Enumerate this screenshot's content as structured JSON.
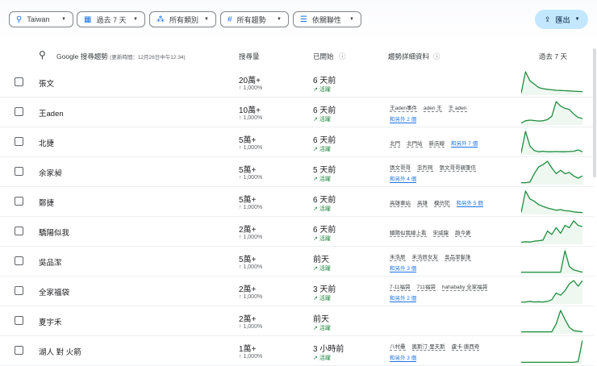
{
  "filters": [
    {
      "icon": "location-pin-icon",
      "glyph": "⚲",
      "label": "Taiwan"
    },
    {
      "icon": "calendar-icon",
      "glyph": "▦",
      "label": "過去 7 天"
    },
    {
      "icon": "category-icon",
      "glyph": "⁂",
      "label": "所有類別"
    },
    {
      "icon": "hashtag-icon",
      "glyph": "#",
      "label": "所有趨勢"
    },
    {
      "icon": "sort-icon",
      "glyph": "☰",
      "label": "依關聯性"
    }
  ],
  "export": {
    "label": "匯出"
  },
  "header": {
    "title": "Google 搜尋趨勢",
    "updated": "(更新時間：12月26日中午12:34)",
    "volume": "搜尋量",
    "started": "已開始",
    "details": "趨勢詳細資料",
    "past": "過去 7 天"
  },
  "accent": "#1e8e3e",
  "rows": [
    {
      "name": "張文",
      "volume": "20萬+",
      "pct": "↑ 1,000%",
      "started": "6 天前",
      "status": "活躍",
      "terms": [],
      "more": "",
      "trend": [
        5,
        100,
        60,
        45,
        30,
        25,
        22,
        20,
        18,
        17,
        16,
        15,
        14,
        13,
        12
      ]
    },
    {
      "name": "王aden",
      "volume": "10萬+",
      "pct": "↑ 1,000%",
      "started": "6 天前",
      "status": "活躍",
      "terms": [
        "王aden事件",
        "aden 王",
        "王 aden"
      ],
      "more": "和另外 2 個",
      "trend": [
        5,
        15,
        18,
        16,
        14,
        15,
        20,
        35,
        100,
        80,
        70,
        65,
        45,
        30,
        25
      ]
    },
    {
      "name": "北捷",
      "volume": "5萬+",
      "pct": "↑ 1,000%",
      "started": "6 天前",
      "status": "活躍",
      "terms": [
        "北門",
        "北門站",
        "新店線"
      ],
      "more": "和另外 7 個",
      "trend": [
        5,
        100,
        35,
        15,
        10,
        12,
        10,
        10,
        11,
        10,
        10,
        11,
        12,
        18,
        10
      ]
    },
    {
      "name": "余家昶",
      "volume": "5萬+",
      "pct": "↑ 1,000%",
      "started": "5 天前",
      "status": "活躍",
      "terms": [
        "張文哥哥",
        "忠烈祠",
        "張文哥哥親筆信"
      ],
      "more": "和另外 4 個",
      "trend": [
        5,
        5,
        8,
        45,
        75,
        85,
        100,
        70,
        45,
        60,
        45,
        50,
        35,
        25,
        35
      ]
    },
    {
      "name": "鄭捷",
      "volume": "5萬+",
      "pct": "↑ 1,000%",
      "started": "6 天前",
      "status": "活躍",
      "terms": [
        "高雄車站",
        "高雄",
        "模仿犯"
      ],
      "more": "和另外 5 個",
      "trend": [
        5,
        100,
        65,
        55,
        40,
        32,
        25,
        20,
        15,
        18,
        13,
        12,
        8,
        6,
        5
      ]
    },
    {
      "name": "驕陽似我",
      "volume": "2萬+",
      "pct": "↑ 1,000%",
      "started": "6 天前",
      "status": "活躍",
      "terms": [
        "驕陽似我線上看",
        "宋威龍",
        "趙今麥"
      ],
      "more": "",
      "trend": [
        5,
        8,
        6,
        10,
        12,
        15,
        55,
        40,
        70,
        45,
        80,
        70,
        100,
        80,
        75
      ]
    },
    {
      "name": "吳品潔",
      "volume": "5萬+",
      "pct": "↑ 1,000%",
      "started": "前天",
      "status": "活躍",
      "terms": [
        "禾浩辰",
        "禾浩辰女友",
        "吳品潔髮誰"
      ],
      "more": "和另外 3 個",
      "trend": [
        5,
        5,
        5,
        5,
        5,
        5,
        5,
        5,
        5,
        5,
        100,
        30,
        15,
        10,
        5
      ]
    },
    {
      "name": "全家福袋",
      "volume": "2萬+",
      "pct": "↑ 1,000%",
      "started": "3 天前",
      "status": "活躍",
      "terms": [
        "7-11福袋",
        "711福袋",
        "hahababy 全家福袋"
      ],
      "more": "和另外 2 個",
      "trend": [
        5,
        5,
        8,
        5,
        6,
        5,
        8,
        15,
        45,
        35,
        55,
        85,
        100,
        75,
        100
      ]
    },
    {
      "name": "夏宇禾",
      "volume": "2萬+",
      "pct": "↑ 1,000%",
      "started": "前天",
      "status": "活躍",
      "terms": [],
      "more": "",
      "trend": [
        5,
        5,
        5,
        5,
        5,
        5,
        5,
        5,
        40,
        100,
        60,
        25,
        10,
        8,
        5
      ]
    },
    {
      "name": "湖人 對 火箭",
      "volume": "1萬+",
      "pct": "↑ 1,000%",
      "started": "3 小時前",
      "status": "活躍",
      "terms": [
        "八村壘",
        "奧斯汀·里夫斯",
        "盧卡·唐西奇"
      ],
      "more": "和另外 3 個",
      "trend": [
        2,
        2,
        2,
        2,
        2,
        2,
        2,
        2,
        2,
        2,
        2,
        2,
        2,
        5,
        100
      ]
    }
  ]
}
